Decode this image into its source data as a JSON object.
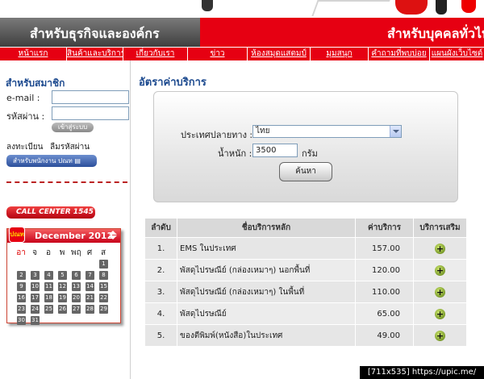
{
  "header": {
    "segment_business": "สำหรับธุรกิจและองค์กร",
    "segment_personal": "สำหรับบุคคลทั่วไป"
  },
  "nav": [
    {
      "label": "หน้าแรก"
    },
    {
      "label": "สินค้าและบริการ"
    },
    {
      "label": "เกี่ยวกับเรา"
    },
    {
      "label": "ข่าว"
    },
    {
      "label": "ห้องสมุดแสตมป์"
    },
    {
      "label": "มุมสนุก"
    },
    {
      "label": "คำถามที่พบบ่อย"
    },
    {
      "label": "แผนผังเว็บไซต์"
    }
  ],
  "sidebar": {
    "member_title": "สำหรับสมาชิก",
    "email_label": "e-mail :",
    "password_label": "รหัสผ่าน :",
    "email_value": "",
    "password_value": "",
    "login_button": "เข้าสู่ระบบ",
    "register_link": "ลงทะเบียน",
    "forgot_link": "ลืมรหัสผ่าน",
    "staff_button": "สำหรับพนักงาน ปณท",
    "callcenter": "CALL CENTER 1545"
  },
  "calendar": {
    "month": "December 2012",
    "days_of_week": [
      "อา",
      "จ",
      "อ",
      "พ",
      "พฤ",
      "ศ",
      "ส"
    ],
    "days": [
      1,
      2,
      3,
      4,
      5,
      6,
      7,
      8,
      9,
      10,
      11,
      12,
      13,
      14,
      15,
      16,
      17,
      18,
      19,
      20,
      21,
      22,
      23,
      24,
      25,
      26,
      27,
      28,
      29,
      30,
      31
    ],
    "first_weekday_index": 6,
    "logo_text": "ปณท"
  },
  "main": {
    "title": "อัตราค่าบริการ",
    "country_label": "ประเทศปลายทาง :",
    "country_value": "ไทย",
    "weight_label": "น้ำหนัก :",
    "weight_value": "3500",
    "weight_unit": "กรัม",
    "search_button": "ค้นหา"
  },
  "table": {
    "headers": [
      "ลำดับ",
      "ชื่อบริการหลัก",
      "ค่าบริการ",
      "บริการเสริม"
    ],
    "rows": [
      {
        "no": "1.",
        "service": "EMS ในประเทศ",
        "price": "157.00"
      },
      {
        "no": "2.",
        "service": "พัสดุไปรษณีย์ (กล่องเหมาๆ) นอกพื้นที่",
        "price": "120.00"
      },
      {
        "no": "3.",
        "service": "พัสดุไปรษณีย์ (กล่องเหมาๆ) ในพื้นที่",
        "price": "110.00"
      },
      {
        "no": "4.",
        "service": "พัสดุไปรษณีย์",
        "price": "65.00"
      },
      {
        "no": "5.",
        "service": "ของตีพิมพ์(หนังสือ)ในประเทศ",
        "price": "49.00"
      }
    ],
    "plus_symbol": "+"
  },
  "watermark": "[711x535] https://upic.me/"
}
